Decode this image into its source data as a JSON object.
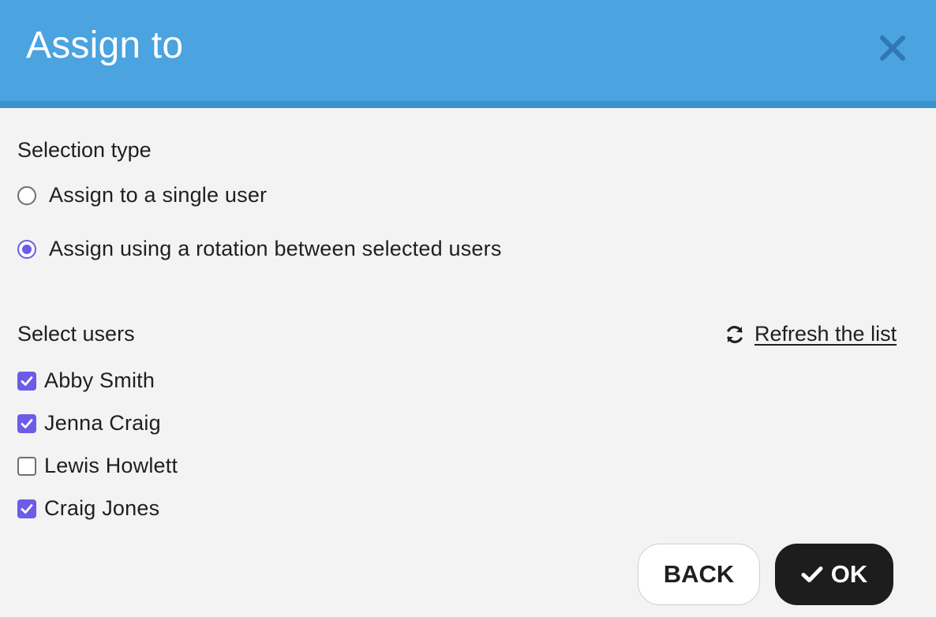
{
  "dialog": {
    "title": "Assign to",
    "close_icon": "close-icon"
  },
  "selection_type": {
    "label": "Selection type",
    "options": [
      {
        "label": "Assign to a single user",
        "selected": false
      },
      {
        "label": "Assign using a rotation between selected users",
        "selected": true
      }
    ]
  },
  "users": {
    "label": "Select users",
    "refresh_label": "Refresh the list",
    "refresh_icon": "refresh-icon",
    "items": [
      {
        "name": "Abby Smith",
        "checked": true
      },
      {
        "name": "Jenna Craig",
        "checked": true
      },
      {
        "name": "Lewis Howlett",
        "checked": false
      },
      {
        "name": "Craig Jones",
        "checked": true
      }
    ]
  },
  "actions": {
    "back_label": "BACK",
    "ok_label": "OK",
    "ok_icon": "check-icon"
  },
  "colors": {
    "header": "#4ba3e0",
    "accent": "#6c5ce7",
    "ok_button": "#1d1d1d"
  }
}
